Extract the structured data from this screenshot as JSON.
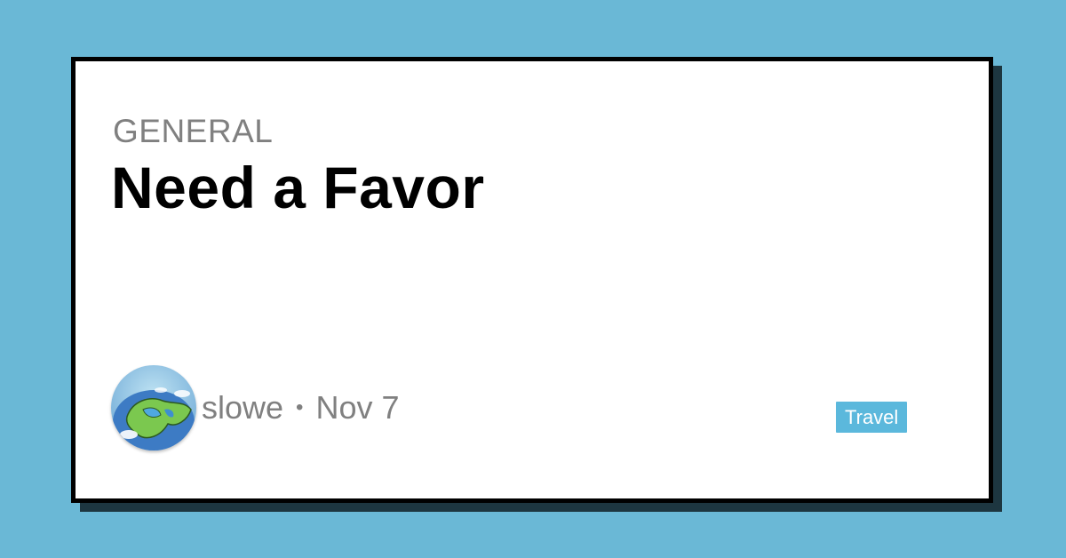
{
  "post": {
    "category": "GENERAL",
    "title": "Need a Favor",
    "author": "slowe",
    "separator": "•",
    "date": "Nov 7",
    "tag": "Travel"
  },
  "colors": {
    "background": "#6ab8d6",
    "card": "#ffffff",
    "border": "#000000",
    "shadow": "#1d3640",
    "muted_text": "#808080",
    "tag_bg": "#5bb8dc",
    "tag_text": "#ffffff"
  },
  "icons": {
    "avatar": "cartoon-globe-avatar"
  }
}
